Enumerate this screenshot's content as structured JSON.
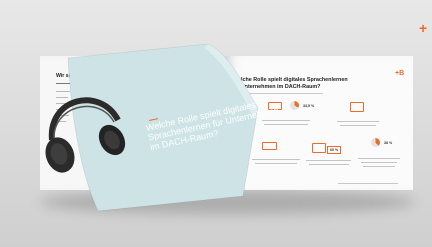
{
  "corner_symbol": "+",
  "left_page": {
    "heading": "Wir sind Babbel für Unternehmen"
  },
  "cover": {
    "title": "Welche Rolle spielt digitales Sprachenlernen für Unternehmen im DACH-Raum?"
  },
  "right_page": {
    "logo": "+B",
    "title": "Welche Rolle spielt digitales Sprachenlernen im Unternehmen im DACH-Raum?",
    "stats": [
      {
        "label": "33,5 %"
      },
      {
        "label": "60 %"
      },
      {
        "label": "38 %"
      }
    ]
  },
  "colors": {
    "accent": "#f06a2a",
    "cover": "#c9dfe3",
    "headphone": "#2b2b2b"
  },
  "icons": [
    "plus-icon",
    "headphones-icon",
    "laptop-icon",
    "people-icon",
    "chart-icon"
  ]
}
